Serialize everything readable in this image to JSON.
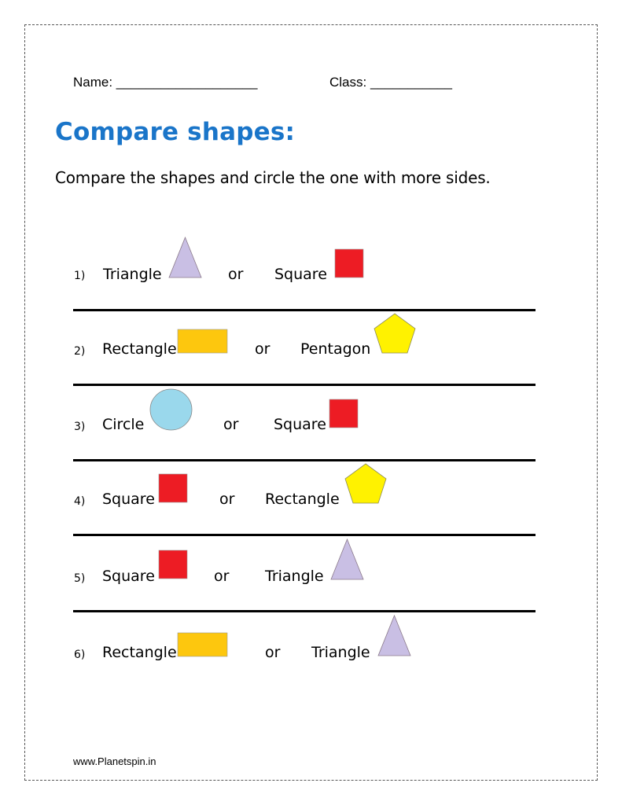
{
  "header": {
    "name_label": "Name: ___________________",
    "class_label": "Class: ___________"
  },
  "title": "Compare shapes:",
  "instruction": "Compare the shapes and circle the one with more sides.",
  "colors": {
    "title": "#1a75c9",
    "triangle": "#c9bfe4",
    "square": "#ed1c24",
    "rectangle": "#fdc70e",
    "pentagon": "#fff200",
    "circle": "#9ad8ec"
  },
  "questions": [
    {
      "number": "1)",
      "left_label": "Triangle",
      "left_shape": "triangle",
      "or": "or",
      "right_label": "Square",
      "right_shape": "square"
    },
    {
      "number": "2)",
      "left_label": "Rectangle",
      "left_shape": "rectangle",
      "or": "or",
      "right_label": "Pentagon",
      "right_shape": "pentagon"
    },
    {
      "number": "3)",
      "left_label": "Circle",
      "left_shape": "circle",
      "or": "or",
      "right_label": "Square",
      "right_shape": "square"
    },
    {
      "number": "4)",
      "left_label": "Square",
      "left_shape": "square",
      "or": "or",
      "right_label": "Rectangle",
      "right_shape": "pentagon"
    },
    {
      "number": "5)",
      "left_label": "Square",
      "left_shape": "square",
      "or": "or",
      "right_label": "Triangle",
      "right_shape": "triangle"
    },
    {
      "number": "6)",
      "left_label": "Rectangle",
      "left_shape": "rectangle",
      "or": "or",
      "right_label": "Triangle",
      "right_shape": "triangle"
    }
  ],
  "footer": "www.Planetspin.in"
}
